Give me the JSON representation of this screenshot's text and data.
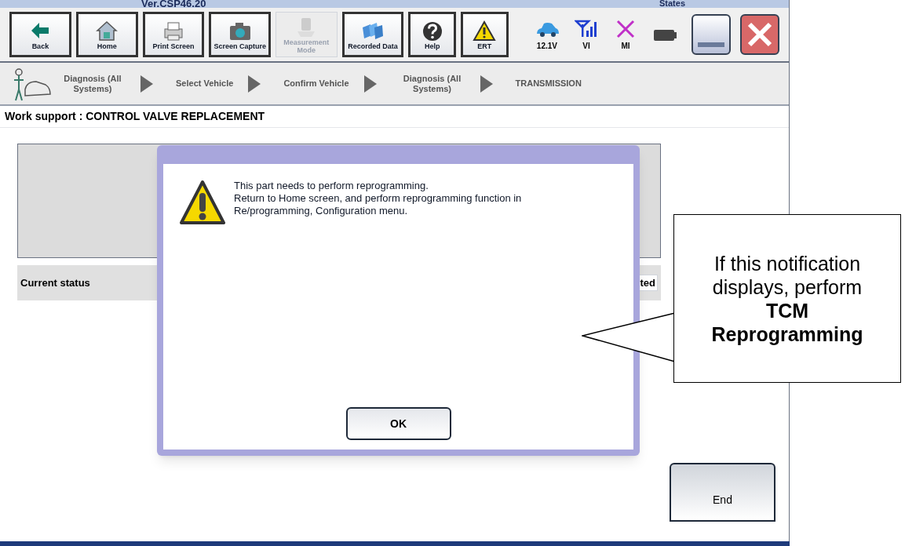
{
  "top_bar": {
    "version": "Ver.CSP46.20",
    "states_label": "States"
  },
  "toolbar": [
    {
      "label": "Back",
      "kind": "back",
      "disabled": false
    },
    {
      "label": "Home",
      "kind": "home",
      "disabled": false
    },
    {
      "label": "Print Screen",
      "kind": "printer",
      "disabled": false
    },
    {
      "label": "Screen Capture",
      "kind": "camera",
      "disabled": false
    },
    {
      "label": "Measurement Mode",
      "kind": "meter",
      "disabled": true
    },
    {
      "label": "Recorded Data",
      "kind": "folders",
      "disabled": false
    },
    {
      "label": "Help",
      "kind": "help",
      "disabled": false
    },
    {
      "label": "ERT",
      "kind": "warning",
      "disabled": false
    }
  ],
  "indicators": [
    {
      "label": "12.1V",
      "kind": "car"
    },
    {
      "label": "VI",
      "kind": "signal"
    },
    {
      "label": "MI",
      "kind": "cross"
    },
    {
      "kind": "battery"
    }
  ],
  "breadcrumb": [
    {
      "label": "Diagnosis (All Systems)"
    },
    {
      "label": "Select Vehicle"
    },
    {
      "label": "Confirm Vehicle"
    },
    {
      "label": "Diagnosis (All Systems)"
    },
    {
      "label": "TRANSMISSION"
    }
  ],
  "page_title": "Work support : CONTROL VALVE REPLACEMENT",
  "current_status_label": "Current status",
  "status_value_fragment": "ted",
  "dialog": {
    "message": [
      "This part needs to perform reprogramming.",
      "Return to Home screen, and perform reprogramming function in",
      "Re/programming, Configuration menu."
    ],
    "ok_button": "OK"
  },
  "end_button": "End",
  "callout": "If this notification displays, perform **TCM Reprogramming**"
}
